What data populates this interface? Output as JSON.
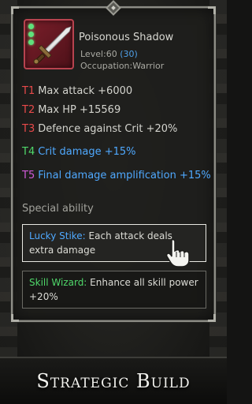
{
  "item": {
    "name": "Poisonous Shadow",
    "level_prefix": "Level:60 ",
    "level_bonus": "(30)",
    "occupation": "Occupation:Warrior",
    "gem_count": 3
  },
  "stats": [
    {
      "tier": "T1",
      "text": "Max attack +6000",
      "tier_color": "#e84a4a",
      "text_color": "#d4d4ce"
    },
    {
      "tier": "T2",
      "text": "Max HP +15569",
      "tier_color": "#e84a4a",
      "text_color": "#d4d4ce"
    },
    {
      "tier": "T3",
      "text": "Defence against Crit +20%",
      "tier_color": "#e84a4a",
      "text_color": "#d4d4ce"
    },
    {
      "tier": "T4",
      "text": "Crit damage +15%",
      "tier_color": "#4fd86a",
      "text_color": "#4fa9ff"
    },
    {
      "tier": "T5",
      "text": "Final damage amplification +15%",
      "tier_color": "#d05ad8",
      "text_color": "#4fa9ff"
    }
  ],
  "special_ability": {
    "label": "Special ability",
    "abilities": [
      {
        "name": "Lucky Stike:",
        "description": " Each attack deals extra damage"
      },
      {
        "name": "Skill Wizard:",
        "description": " Enhance all skill power +20%"
      }
    ]
  },
  "banner": {
    "title": "Strategic Build"
  },
  "colors": {
    "level_highlight": "#4fa0e8",
    "icon_frame": "#b8434f",
    "gem": "#5fe27c"
  },
  "icons": [
    "sword-icon",
    "gem-icon",
    "pointing-hand-icon"
  ]
}
